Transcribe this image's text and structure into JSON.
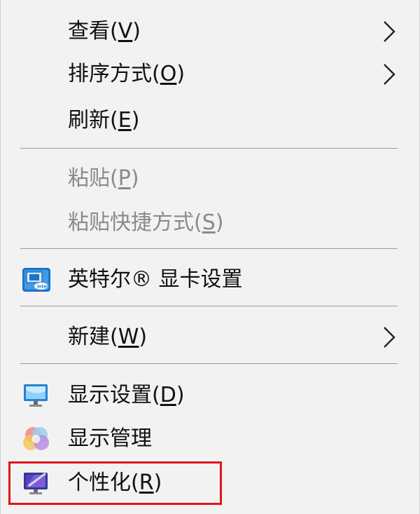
{
  "menu": {
    "items": [
      {
        "id": "view",
        "text": "查看(",
        "accel": "V",
        "suffix": ")",
        "submenu": true,
        "disabled": false
      },
      {
        "id": "sort",
        "text": "排序方式(",
        "accel": "O",
        "suffix": ")",
        "submenu": true,
        "disabled": false
      },
      {
        "id": "refresh",
        "text": "刷新(",
        "accel": "E",
        "suffix": ")",
        "submenu": false,
        "disabled": false
      },
      {
        "id": "paste",
        "text": "粘贴(",
        "accel": "P",
        "suffix": ")",
        "submenu": false,
        "disabled": true
      },
      {
        "id": "paste-shortcut",
        "text": "粘贴快捷方式(",
        "accel": "S",
        "suffix": ")",
        "submenu": false,
        "disabled": true
      },
      {
        "id": "intel",
        "text": "英特尔® 显卡设置",
        "accel": "",
        "suffix": "",
        "icon": "intel-graphics-icon",
        "submenu": false,
        "disabled": false
      },
      {
        "id": "new",
        "text": "新建(",
        "accel": "W",
        "suffix": ")",
        "submenu": true,
        "disabled": false
      },
      {
        "id": "display-settings",
        "text": "显示设置(",
        "accel": "D",
        "suffix": ")",
        "icon": "display-settings-icon",
        "submenu": false,
        "disabled": false
      },
      {
        "id": "display-manage",
        "text": "显示管理",
        "accel": "",
        "suffix": "",
        "icon": "color-circles-icon",
        "submenu": false,
        "disabled": false
      },
      {
        "id": "personalize",
        "text": "个性化(",
        "accel": "R",
        "suffix": ")",
        "icon": "personalize-icon",
        "submenu": false,
        "disabled": false,
        "highlighted": true
      }
    ]
  },
  "colors": {
    "background": "#f2f2f2",
    "text": "#111111",
    "disabled_text": "#8a8a8a",
    "separator": "#9a9a9a",
    "highlight_border": "#e0151b"
  }
}
